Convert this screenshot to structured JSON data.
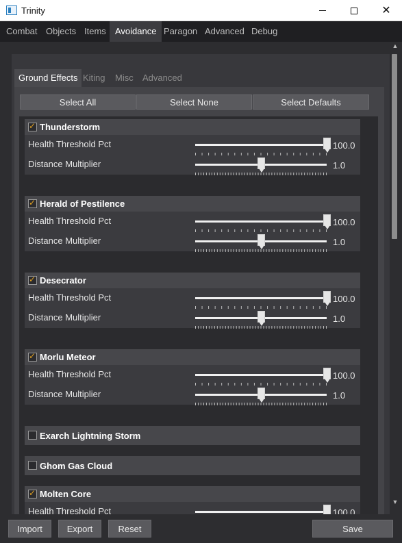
{
  "window": {
    "title": "Trinity",
    "icon": "app-window-icon"
  },
  "top_tabs": [
    {
      "label": "Combat",
      "active": false
    },
    {
      "label": "Objects",
      "active": false
    },
    {
      "label": "Items",
      "active": false
    },
    {
      "label": "Avoidance",
      "active": true
    },
    {
      "label": "Paragon",
      "active": false
    },
    {
      "label": "Advanced",
      "active": false
    },
    {
      "label": "Debug",
      "active": false
    }
  ],
  "sub_tabs": [
    {
      "label": "Ground Effects",
      "active": true
    },
    {
      "label": "Kiting",
      "active": false
    },
    {
      "label": "Misc",
      "active": false
    },
    {
      "label": "Advanced",
      "active": false
    }
  ],
  "select_buttons": {
    "all": "Select All",
    "none": "Select None",
    "defaults": "Select Defaults"
  },
  "groups": [
    {
      "title": "Thunderstorm",
      "checked": true,
      "rows": [
        {
          "label": "Health Threshold Pct",
          "value": "100.0",
          "fraction": 1.0
        },
        {
          "label": "Distance Multiplier",
          "value": "1.0",
          "fraction": 0.5
        }
      ]
    },
    {
      "title": "Herald of Pestilence",
      "checked": true,
      "rows": [
        {
          "label": "Health Threshold Pct",
          "value": "100.0",
          "fraction": 1.0
        },
        {
          "label": "Distance Multiplier",
          "value": "1.0",
          "fraction": 0.5
        }
      ]
    },
    {
      "title": "Desecrator",
      "checked": true,
      "rows": [
        {
          "label": "Health Threshold Pct",
          "value": "100.0",
          "fraction": 1.0
        },
        {
          "label": "Distance Multiplier",
          "value": "1.0",
          "fraction": 0.5
        }
      ]
    },
    {
      "title": "Morlu Meteor",
      "checked": true,
      "rows": [
        {
          "label": "Health Threshold Pct",
          "value": "100.0",
          "fraction": 1.0
        },
        {
          "label": "Distance Multiplier",
          "value": "1.0",
          "fraction": 0.5
        }
      ]
    },
    {
      "title": "Exarch Lightning Storm",
      "checked": false,
      "rows": []
    },
    {
      "title": "Ghom Gas Cloud",
      "checked": false,
      "rows": []
    },
    {
      "title": "Molten Core",
      "checked": true,
      "rows": [
        {
          "label": "Health Threshold Pct",
          "value": "100.0",
          "fraction": 1.0
        }
      ]
    }
  ],
  "bottom_buttons": {
    "import": "Import",
    "export": "Export",
    "reset": "Reset",
    "save": "Save"
  },
  "colors": {
    "accent_check": "#e0a020",
    "background": "#2d2d30",
    "active_tab": "#3c3c40"
  }
}
